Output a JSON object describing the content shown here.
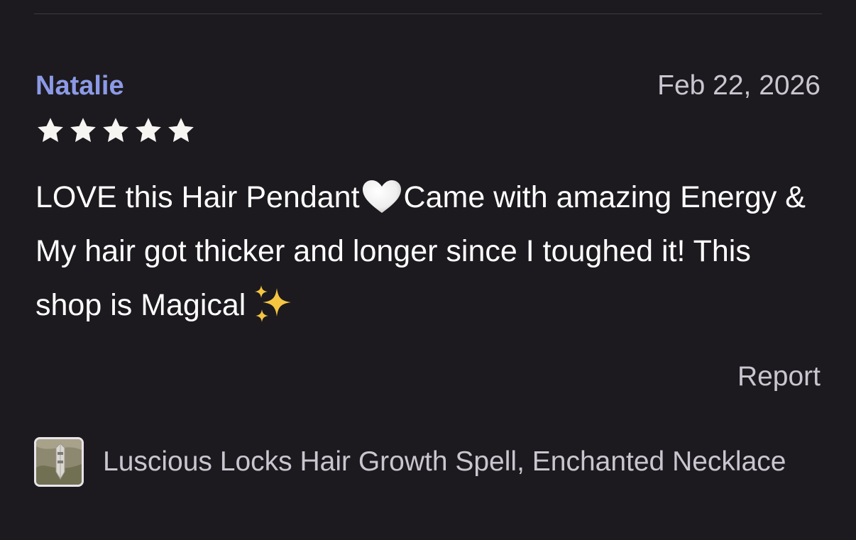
{
  "review": {
    "reviewer_name": "Natalie",
    "date": "Feb 22, 2026",
    "rating": 5,
    "text_part1": "LOVE this Hair Pendant",
    "text_part2": "Came with amazing Energy & My hair got thicker and longer since I toughed it! This shop is Magical",
    "report_label": "Report"
  },
  "product": {
    "title": "Luscious Locks Hair Growth Spell, Enchanted Necklace"
  },
  "colors": {
    "background": "#1c1a1f",
    "reviewer_name": "#8c9ae6",
    "secondary_text": "#c9c6cf",
    "star": "#f7f5f2"
  },
  "icons": {
    "rating": "star-icon",
    "heart": "white-heart-icon",
    "sparkles": "sparkles-icon",
    "product_thumbnail": "product-thumbnail"
  }
}
